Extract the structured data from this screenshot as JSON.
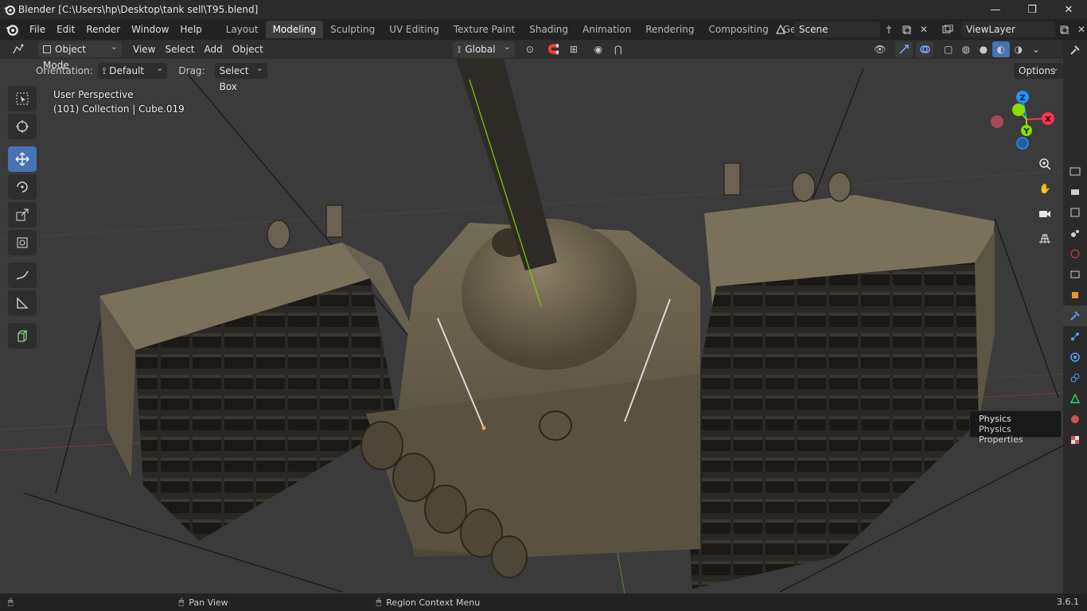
{
  "window": {
    "title": "Blender [C:\\Users\\hp\\Desktop\\tank sell\\T95.blend]",
    "controls": [
      "—",
      "❐",
      "✕"
    ]
  },
  "menu": [
    "File",
    "Edit",
    "Render",
    "Window",
    "Help"
  ],
  "workspaces": [
    "Layout",
    "Modeling",
    "Sculpting",
    "UV Editing",
    "Texture Paint",
    "Shading",
    "Animation",
    "Rendering",
    "Compositing",
    "Geometry Noc"
  ],
  "active_workspace": "Modeling",
  "scene": {
    "name": "Scene",
    "view_layer": "ViewLayer"
  },
  "viewport_header": {
    "mode": "Object Mode",
    "menus": [
      "View",
      "Select",
      "Add",
      "Object"
    ],
    "transform_orientation": "Global"
  },
  "tool_settings": {
    "orientation_label": "Orientation:",
    "orientation_value": "Default",
    "drag_label": "Drag:",
    "drag_value": "Select Box",
    "options_label": "Options"
  },
  "viewport_overlay": {
    "view_name": "User Perspective",
    "collection_info": "(101) Collection | Cube.019"
  },
  "gizmo_axes": {
    "x": "X",
    "y": "Y",
    "z": "Z"
  },
  "tooltip": {
    "title": "Physics",
    "subtitle": "Physics Properties"
  },
  "statusbar": {
    "left_action": "Pan View",
    "right_action": "Region Context Menu",
    "version": "3.6.1"
  },
  "colors": {
    "active_tool": "#4772b3",
    "axis_x": "#ff3352",
    "axis_y": "#8bdc00",
    "axis_z": "#2890ff",
    "tank_body": "#6e6550"
  },
  "icons": {
    "toolbar": [
      "select-box-icon",
      "cursor-icon",
      "move-icon",
      "rotate-icon",
      "scale-icon",
      "transform-icon",
      "annotate-icon",
      "measure-icon",
      "add-cube-icon"
    ],
    "nav": [
      "zoom-icon",
      "hand-icon",
      "camera-icon",
      "grid-icon"
    ],
    "properties": [
      "tool-icon",
      "render-icon",
      "output-icon",
      "view-layer-icon",
      "scene-icon",
      "world-icon",
      "collection-icon",
      "object-icon",
      "modifier-icon",
      "particles-icon",
      "physics-icon",
      "constraints-icon",
      "data-icon",
      "material-icon",
      "texture-icon"
    ]
  }
}
